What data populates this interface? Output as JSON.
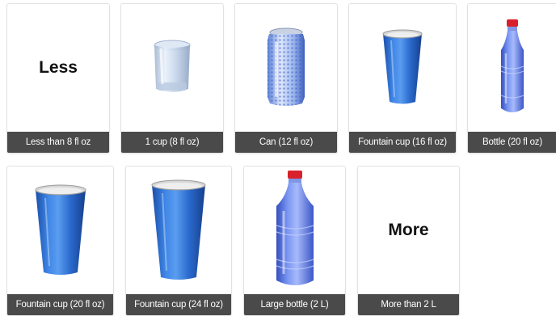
{
  "options": [
    {
      "label": "Less than 8 fl oz",
      "icon": "less-text-icon",
      "text": "Less"
    },
    {
      "label": "1 cup (8 fl oz)",
      "icon": "glass-cup-icon"
    },
    {
      "label": "Can (12 fl oz)",
      "icon": "soda-can-icon"
    },
    {
      "label": "Fountain cup (16 fl oz)",
      "icon": "fountain-cup-icon"
    },
    {
      "label": "Bottle (20 fl oz)",
      "icon": "bottle-icon"
    },
    {
      "label": "Fountain cup (20 fl oz)",
      "icon": "fountain-cup-icon"
    },
    {
      "label": "Fountain cup (24 fl oz)",
      "icon": "fountain-cup-icon"
    },
    {
      "label": "Large bottle (2 L)",
      "icon": "large-bottle-icon"
    },
    {
      "label": "More than 2 L",
      "icon": "more-text-icon",
      "text": "More"
    }
  ],
  "colors": {
    "caption_bg": "#4a4a4a",
    "caption_text": "#ffffff",
    "cup_blue": "#2f72d6",
    "cap_red": "#d9212b"
  }
}
